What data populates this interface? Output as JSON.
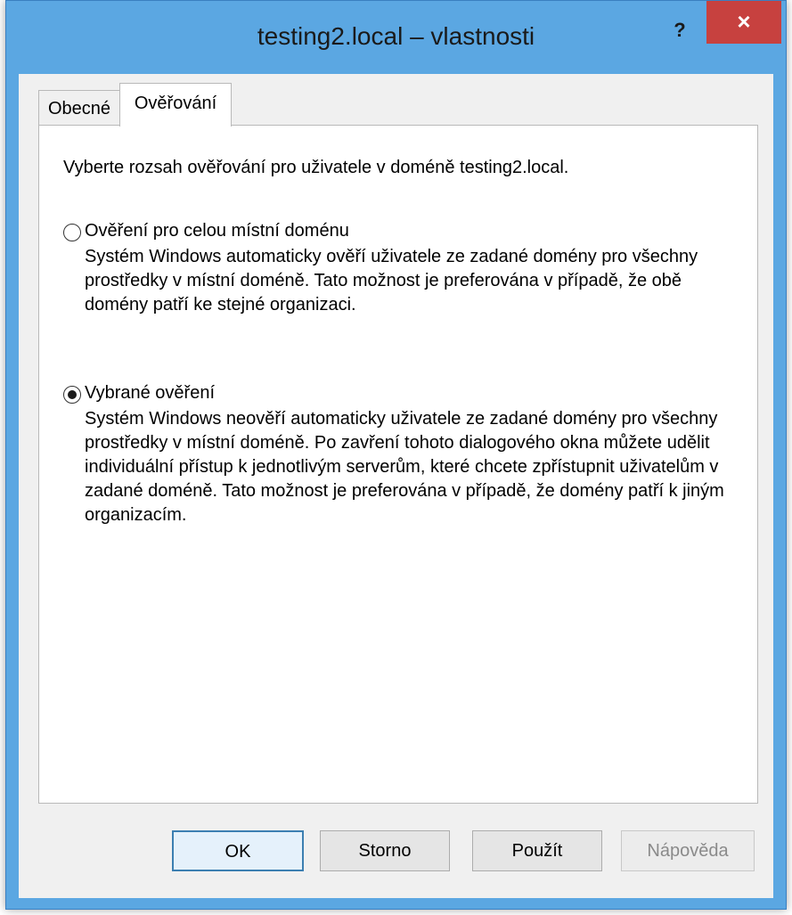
{
  "window": {
    "title": "testing2.local – vlastnosti",
    "help_label": "?",
    "close_label": "×"
  },
  "tabs": [
    {
      "label": "Obecné",
      "active": false
    },
    {
      "label": "Ověřování",
      "active": true
    }
  ],
  "content": {
    "intro": "Vyberte rozsah ověřování pro uživatele v doméně testing2.local.",
    "options": [
      {
        "label": "Ověření pro celou místní doménu",
        "selected": false,
        "description": "Systém Windows automaticky ověří uživatele ze zadané domény pro všechny prostředky v místní doméně. Tato možnost je preferována v případě, že obě domény patří ke stejné organizaci."
      },
      {
        "label": "Vybrané ověření",
        "selected": true,
        "description": "Systém Windows neověří automaticky uživatele ze zadané domény pro všechny prostředky v místní doméně. Po zavření tohoto dialogového okna můžete udělit individuální přístup k jednotlivým serverům, které chcete zpřístupnit uživatelům v zadané doméně. Tato možnost je preferována v případě, že domény patří k jiným organizacím."
      }
    ]
  },
  "buttons": {
    "ok": "OK",
    "cancel": "Storno",
    "apply": "Použít",
    "help": "Nápověda"
  },
  "colors": {
    "titlebar": "#5ba7e2",
    "close_button": "#c7413f",
    "default_button_border": "#3c7fb1"
  }
}
